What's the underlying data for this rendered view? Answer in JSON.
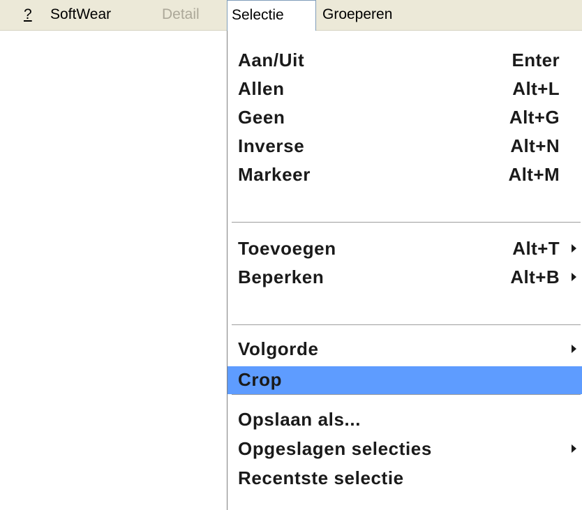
{
  "menubar": {
    "help": "?",
    "softwear": "SoftWear",
    "detail": "Detail",
    "selectie": "Selectie",
    "groeperen": "Groeperen"
  },
  "menu": {
    "items": [
      {
        "label": "Aan/Uit",
        "shortcut": "Enter"
      },
      {
        "label": "Allen",
        "shortcut": "Alt+L"
      },
      {
        "label": "Geen",
        "shortcut": "Alt+G"
      },
      {
        "label": "Inverse",
        "shortcut": "Alt+N"
      },
      {
        "label": "Markeer",
        "shortcut": "Alt+M"
      },
      {
        "label": "Toevoegen",
        "shortcut": "Alt+T",
        "submenu": true
      },
      {
        "label": "Beperken",
        "shortcut": "Alt+B",
        "submenu": true
      },
      {
        "label": "Volgorde",
        "shortcut": "",
        "submenu": true
      },
      {
        "label": "Crop",
        "shortcut": "",
        "highlighted": true
      },
      {
        "label": "Opslaan als...",
        "shortcut": ""
      },
      {
        "label": "Opgeslagen selecties",
        "shortcut": "",
        "submenu": true
      },
      {
        "label": "Recentste selectie",
        "shortcut": ""
      }
    ]
  },
  "colors": {
    "menubar_bg": "#ece9d8",
    "highlight": "#5e9cff",
    "disabled_text": "#aca899"
  },
  "icons": {
    "submenu": "submenu-arrow-icon"
  }
}
